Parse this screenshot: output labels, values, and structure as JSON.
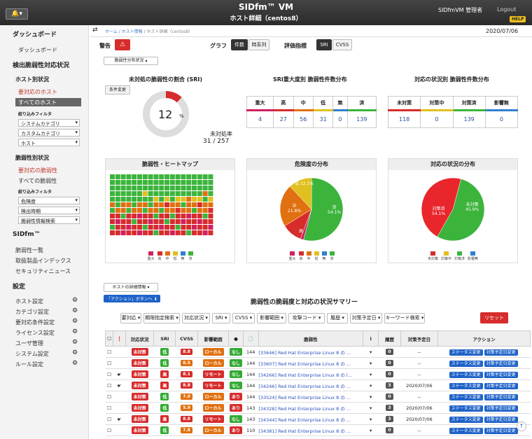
{
  "header": {
    "title": "SIDfm™ VM",
    "subtitle": "ホスト詳細（centos8）",
    "user": "SIDfmVM 管理者",
    "logout": "Logout",
    "help": "HELP",
    "bell": "🔔▾"
  },
  "sidebar": {
    "dashboard_head": "ダッシュボード",
    "dashboard": "ダッシュボード",
    "vuln_head": "検出脆弱性対応状況",
    "host_head": "ホスト別状況",
    "need_host": "要対応のホスト",
    "all_host": "すべてのホスト",
    "filter1": "絞り込みフィルタ",
    "system_cat": "システムカテゴリ",
    "custom_cat": "カスタムカテゴリ",
    "host": "ホスト",
    "vuln_status": "脆弱性別状況",
    "need_vuln": "要対応の脆弱性",
    "all_vuln": "すべての脆弱性",
    "filter2": "絞り込みフィルタ",
    "risk": "危険度",
    "detect": "検出時期",
    "vuln_search": "脆弱性情報検索",
    "sidfm": "SIDfm™",
    "vuln_list": "脆弱性一覧",
    "products": "取扱製品インデックス",
    "news": "セキュリティニュース",
    "settings": "設定",
    "set_host": "ホスト設定",
    "set_cat": "カテゴリ設定",
    "set_cond": "要対応条件設定",
    "set_lic": "ライセンス設定",
    "set_user": "ユーザ管理",
    "set_sys": "システム設定",
    "set_rule": "ルール設定"
  },
  "crumb": {
    "home": "ホーム",
    "info": "ホスト情報",
    "detail": "ホスト詳細（centos8）"
  },
  "date": "2020/07/06",
  "toolbar": {
    "warn": "警告",
    "graph": "グラフ",
    "count": "件数",
    "series": "時系列",
    "metric": "評価指標",
    "sri": "SRI",
    "cvss": "CVSS",
    "dist_select": "脆弱性分布状況 ▴"
  },
  "donut": {
    "title": "未対処の脆弱性の割合 (SRI)",
    "btn": "条件変更",
    "pct": "12",
    "unit": "%",
    "rate_label": "未対処率",
    "rate": "31 / 257",
    "value": 12
  },
  "sev": {
    "title": "SRI重大度別 脆弱性件数分布",
    "heads": [
      "重大",
      "高",
      "中",
      "低",
      "無",
      "済"
    ],
    "vals": [
      "4",
      "27",
      "56",
      "31",
      "0",
      "139"
    ],
    "colors": [
      "#d02060",
      "#d62c2c",
      "#e07010",
      "#e0c020",
      "#3080d0",
      "#3cb43c"
    ]
  },
  "stat": {
    "title": "対応の状況別 脆弱性件数分布",
    "heads": [
      "未対策",
      "対策中",
      "対策済",
      "影響無"
    ],
    "vals": [
      "118",
      "0",
      "139",
      "0"
    ],
    "colors": [
      "#d62c2c",
      "#e0c020",
      "#3cb43c",
      "#3080d0"
    ]
  },
  "heat": {
    "title": "脆弱性・ヒートマップ",
    "legend": [
      "重大",
      "高",
      "中",
      "低",
      "無",
      "済"
    ]
  },
  "risk_pie": {
    "title": "危険度の分布",
    "legend": [
      "重大",
      "高",
      "中",
      "低",
      "無",
      "済"
    ],
    "slices": [
      {
        "label": "済",
        "pct": 54.1,
        "color": "#3cb43c"
      },
      {
        "label": "重大",
        "pct": 1.6,
        "color": "#d02060"
      },
      {
        "label": "高",
        "pct": 10.5,
        "color": "#d62c2c"
      },
      {
        "label": "中",
        "pct": 21.8,
        "color": "#e07010"
      },
      {
        "label": "低",
        "pct": 12.1,
        "color": "#e0c020"
      }
    ],
    "text_sumi": "済",
    "text_sumi_pct": "54.1%",
    "text_chu": "中",
    "text_chu_pct": "21.8%",
    "text_tei": "12.1%",
    "text_tei_l": "低",
    "text_ko": "高"
  },
  "stat_pie": {
    "title": "対応の状況の分布",
    "legend": [
      "未対策",
      "対策中",
      "対策済",
      "影響無"
    ],
    "slices": [
      {
        "label": "対策済",
        "pct": 54.1,
        "color": "#3cb43c"
      },
      {
        "label": "未対策",
        "pct": 45.9,
        "color": "#e8262c"
      }
    ],
    "t1": "対策済",
    "t1p": "54.1%",
    "t2": "未対策",
    "t2p": "45.9%"
  },
  "summary": {
    "detail_btn": "ホストの詳細情報 ▾",
    "action_btn": "「アクション」ボタンへ ⬇",
    "title": "脆弱性の脆弱度と対応の状況サマリー"
  },
  "filters": [
    "要対応 ▾",
    "期限指定検索 ▾",
    "対応状況 ▾",
    "SRI ▾",
    "CVSS ▾",
    "影響範囲 ▾",
    "攻撃コード ▾",
    "履歴 ▾",
    "対策予定日 ▾",
    "キーワード検索 ▾"
  ],
  "reset": "リセット",
  "cols": [
    "対応状況",
    "SRI",
    "CVSS",
    "影響範囲",
    "",
    "",
    "脆弱性",
    "",
    "履歴",
    "対策予定日",
    "アクション"
  ],
  "rows": [
    {
      "hand": "",
      "st": "未対策",
      "sri": "低",
      "sc": "g",
      "cvss": "8.8",
      "scope": "ローカル",
      "ex": "なし",
      "no": "144",
      "name": "[33646] Red Hat Enterprise Linux 8 の ...",
      "h": "0",
      "date": "--"
    },
    {
      "hand": "",
      "st": "未対策",
      "sri": "低",
      "sc": "g",
      "cvss": "6.5",
      "scope": "ローカル",
      "ex": "なし",
      "no": "144",
      "name": "[33607] Red Hat Enterprise Linux 8 の ...",
      "h": "0",
      "date": "--"
    },
    {
      "hand": "☛",
      "st": "未対策",
      "sri": "高",
      "sc": "r",
      "cvss": "8.1",
      "scope": "リモート",
      "ex": "なし",
      "no": "144",
      "name": "[34266] Red Hat Enterprise Linux 8 の l...",
      "h": "0",
      "date": "--"
    },
    {
      "hand": "☛",
      "st": "未対策",
      "sri": "高",
      "sc": "r",
      "cvss": "8.8",
      "scope": "リモート",
      "ex": "なし",
      "no": "144",
      "name": "[34246] Red Hat Enterprise Linux 8 の ...",
      "h": "3",
      "date": "2020/07/06"
    },
    {
      "hand": "",
      "st": "未対策",
      "sri": "低",
      "sc": "g",
      "cvss": "7.0",
      "scope": "ローカル",
      "ex": "あり",
      "no": "144",
      "name": "[33524] Red Hat Enterprise Linux 8 の ...",
      "h": "0",
      "date": "--"
    },
    {
      "hand": "",
      "st": "未対策",
      "sri": "低",
      "sc": "g",
      "cvss": "5.9",
      "scope": "ローカル",
      "ex": "あり",
      "no": "143",
      "name": "[34328] Red Hat Enterprise Linux 8 の ...",
      "h": "3",
      "date": "2020/07/06"
    },
    {
      "hand": "☛",
      "st": "未対策",
      "sri": "高",
      "sc": "r",
      "cvss": "8.8",
      "scope": "リモート",
      "ex": "なし",
      "no": "143",
      "name": "[34344] Red Hat Enterprise Linux 8 の ...",
      "h": "3",
      "date": "2020/07/06"
    },
    {
      "hand": "",
      "st": "未対策",
      "sri": "低",
      "sc": "g",
      "cvss": "7.8",
      "scope": "ローカル",
      "ex": "あり",
      "no": "110",
      "name": "[34381] Red Hat Enterprise Linux 8 の ...",
      "h": "0",
      "date": "--"
    }
  ],
  "row_btn1": "ステータス変更",
  "row_btn2": "対策予定日変更"
}
